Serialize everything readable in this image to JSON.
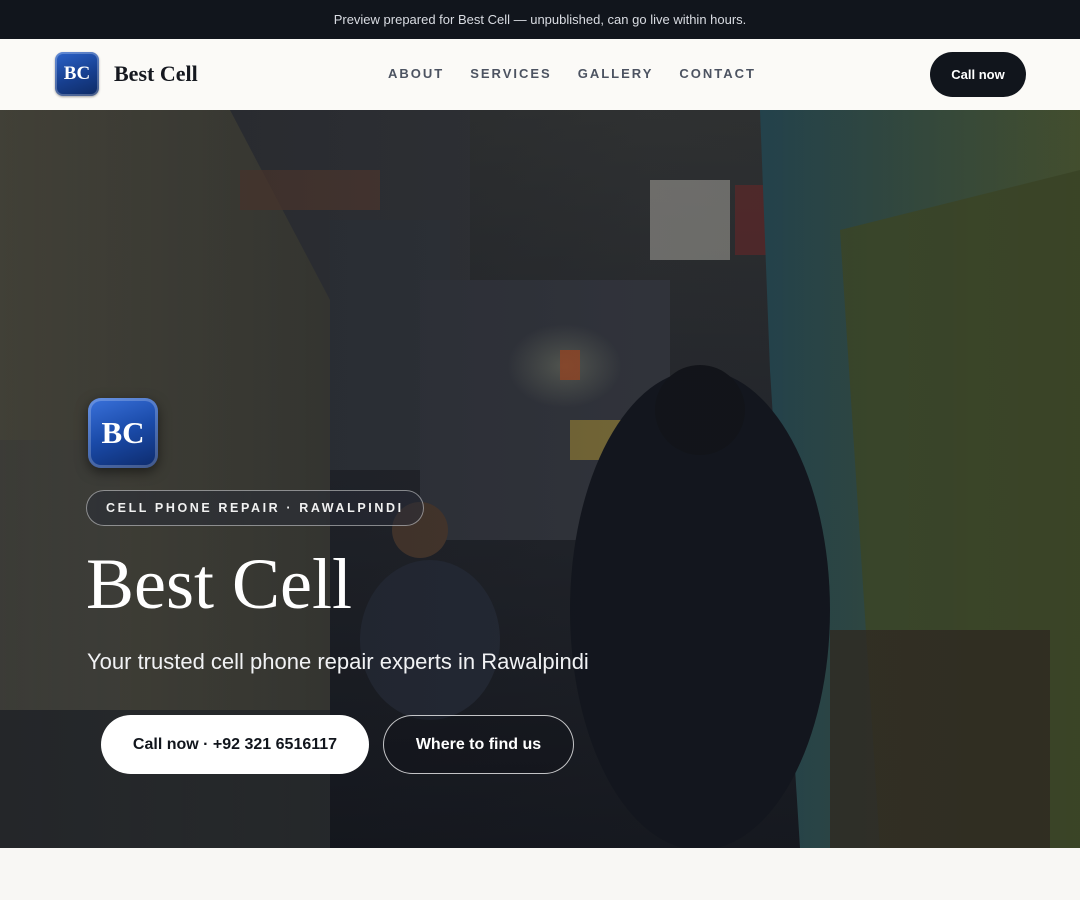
{
  "topbar": {
    "text": "Preview prepared for Best Cell — unpublished, can go live within hours."
  },
  "header": {
    "logo_initials": "BC",
    "brand": "Best Cell",
    "nav": [
      {
        "label": "ABOUT"
      },
      {
        "label": "SERVICES"
      },
      {
        "label": "GALLERY"
      },
      {
        "label": "CONTACT"
      }
    ],
    "cta_label": "Call now"
  },
  "hero": {
    "logo_initials": "BC",
    "eyebrow": "CELL PHONE REPAIR · RAWALPINDI",
    "title": "Best Cell",
    "subtitle": "Your trusted cell phone repair experts in Rawalpindi",
    "primary_button": "Call now · +92 321 6516117",
    "secondary_button": "Where to find us",
    "background_image": "market-alley-photo"
  },
  "colors": {
    "dark": "#11151c",
    "brand_blue": "#1a4aa8",
    "page_bg": "#f8f7f4"
  }
}
